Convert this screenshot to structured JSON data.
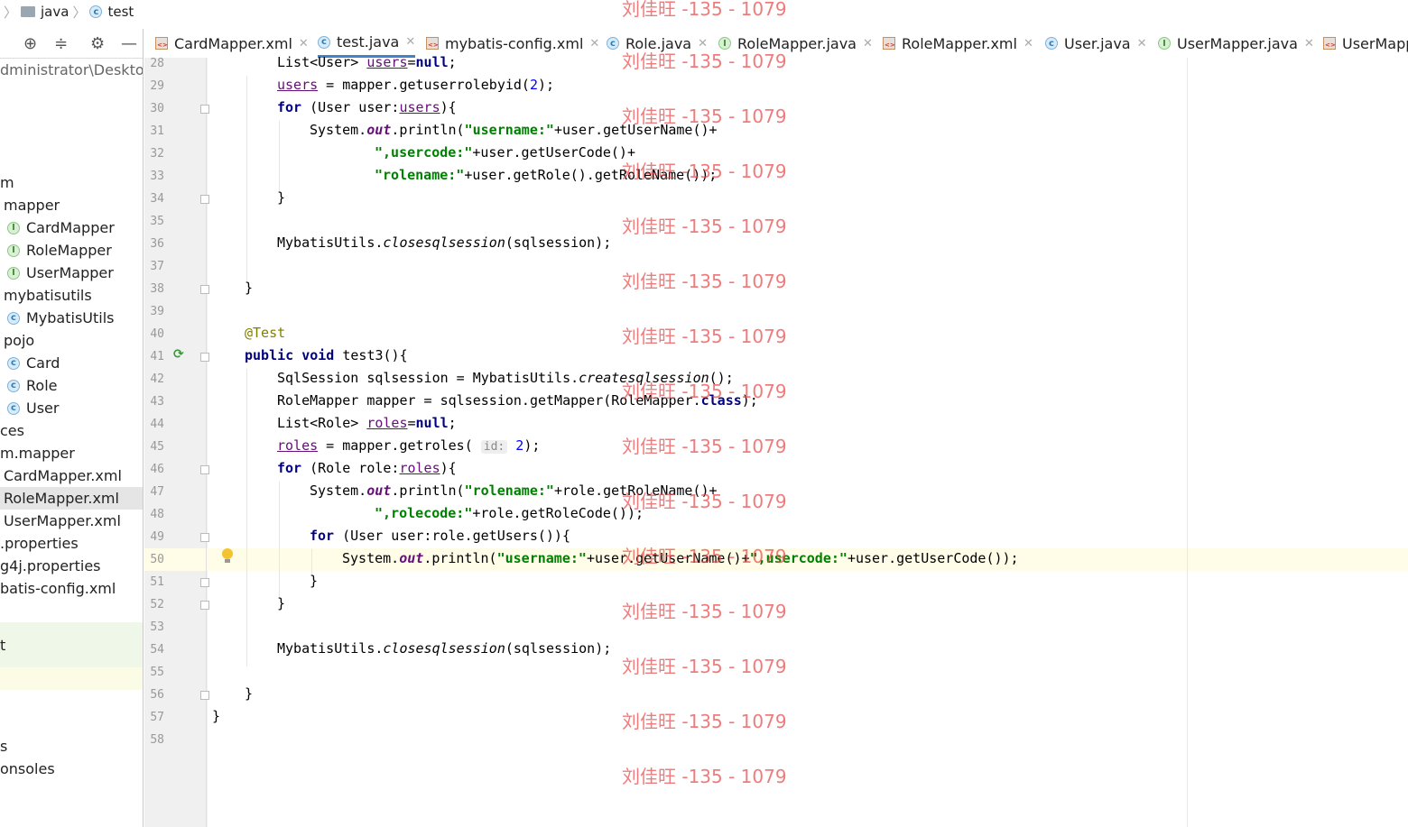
{
  "breadcrumb": {
    "folder": "java",
    "file": "test"
  },
  "sidebar": {
    "path_text": "dministrator\\Desktop\\",
    "items": [
      {
        "label": "m",
        "icon": ""
      },
      {
        "label": "mapper",
        "icon": ""
      },
      {
        "label": "CardMapper",
        "icon": "interface-icon"
      },
      {
        "label": "RoleMapper",
        "icon": "interface-icon"
      },
      {
        "label": "UserMapper",
        "icon": "interface-icon"
      },
      {
        "label": "mybatisutils",
        "icon": ""
      },
      {
        "label": "MybatisUtils",
        "icon": "class-icon"
      },
      {
        "label": "pojo",
        "icon": ""
      },
      {
        "label": "Card",
        "icon": "class-icon"
      },
      {
        "label": "Role",
        "icon": "class-icon"
      },
      {
        "label": "User",
        "icon": "class-icon"
      },
      {
        "label": "ces",
        "icon": ""
      },
      {
        "label": "m.mapper",
        "icon": ""
      },
      {
        "label": "CardMapper.xml",
        "icon": ""
      },
      {
        "label": "RoleMapper.xml",
        "icon": ""
      },
      {
        "label": "UserMapper.xml",
        "icon": ""
      },
      {
        "label": ".properties",
        "icon": ""
      },
      {
        "label": "g4j.properties",
        "icon": ""
      },
      {
        "label": "batis-config.xml",
        "icon": ""
      },
      {
        "label": "t",
        "icon": ""
      },
      {
        "label": "s",
        "icon": ""
      },
      {
        "label": "onsoles",
        "icon": ""
      }
    ]
  },
  "tabs": [
    {
      "label": "CardMapper.xml",
      "icon": "xml-file-icon"
    },
    {
      "label": "test.java",
      "icon": "class-icon",
      "active": true
    },
    {
      "label": "mybatis-config.xml",
      "icon": "xml-file-icon"
    },
    {
      "label": "Role.java",
      "icon": "class-icon"
    },
    {
      "label": "RoleMapper.java",
      "icon": "interface-icon"
    },
    {
      "label": "RoleMapper.xml",
      "icon": "xml-file-icon"
    },
    {
      "label": "User.java",
      "icon": "class-icon"
    },
    {
      "label": "UserMapper.java",
      "icon": "interface-icon"
    },
    {
      "label": "UserMapp",
      "icon": "xml-file-icon"
    }
  ],
  "editor": {
    "current_line": 50,
    "line_numbers": [
      "28",
      "29",
      "30",
      "31",
      "32",
      "33",
      "34",
      "35",
      "36",
      "37",
      "38",
      "39",
      "40",
      "41",
      "42",
      "43",
      "44",
      "45",
      "46",
      "47",
      "48",
      "49",
      "50",
      "51",
      "52",
      "53",
      "54",
      "55",
      "56",
      "57",
      "58"
    ],
    "lines": [
      {
        "n": 28,
        "text": "List<User> users=null;"
      },
      {
        "n": 29,
        "text": "users = mapper.getuserrolebyid(2);"
      },
      {
        "n": 30,
        "text": "for (User user:users){"
      },
      {
        "n": 31,
        "text": "System.out.println(\"username:\"+user.getUserName()+"
      },
      {
        "n": 32,
        "text": "\",usercode:\"+user.getUserCode()+"
      },
      {
        "n": 33,
        "text": "\"rolename:\"+user.getRole().getRoleName());"
      },
      {
        "n": 34,
        "text": "}"
      },
      {
        "n": 35,
        "text": ""
      },
      {
        "n": 36,
        "text": "MybatisUtils.closesqlsession(sqlsession);"
      },
      {
        "n": 37,
        "text": ""
      },
      {
        "n": 38,
        "text": "}"
      },
      {
        "n": 39,
        "text": ""
      },
      {
        "n": 40,
        "text": "@Test"
      },
      {
        "n": 41,
        "text": "public void test3(){"
      },
      {
        "n": 42,
        "text": "SqlSession sqlsession = MybatisUtils.createsqlsession();"
      },
      {
        "n": 43,
        "text": "RoleMapper mapper = sqlsession.getMapper(RoleMapper.class);"
      },
      {
        "n": 44,
        "text": "List<Role> roles=null;"
      },
      {
        "n": 45,
        "text": "roles = mapper.getroles( id: 2);"
      },
      {
        "n": 46,
        "text": "for (Role role:roles){"
      },
      {
        "n": 47,
        "text": "System.out.println(\"rolename:\"+role.getRoleName()+"
      },
      {
        "n": 48,
        "text": "\",rolecode:\"+role.getRoleCode());"
      },
      {
        "n": 49,
        "text": "for (User user:role.getUsers()){"
      },
      {
        "n": 50,
        "text": "System.out.println(\"username:\"+user.getUserName()+\",usercode:\"+user.getUserCode());"
      },
      {
        "n": 51,
        "text": "}"
      },
      {
        "n": 52,
        "text": "}"
      },
      {
        "n": 53,
        "text": ""
      },
      {
        "n": 54,
        "text": "MybatisUtils.closesqlsession(sqlsession);"
      },
      {
        "n": 55,
        "text": ""
      },
      {
        "n": 56,
        "text": "}"
      },
      {
        "n": 57,
        "text": "}"
      },
      {
        "n": 58,
        "text": ""
      }
    ]
  },
  "watermark": {
    "text": "刘佳旺 -135 - 1079",
    "color": "#e84a4a"
  },
  "colors": {
    "keyword": "#000080",
    "string": "#008000",
    "number": "#0000ff",
    "field": "#660e7a",
    "annotation": "#808000",
    "current_line_bg": "#fffde8"
  }
}
